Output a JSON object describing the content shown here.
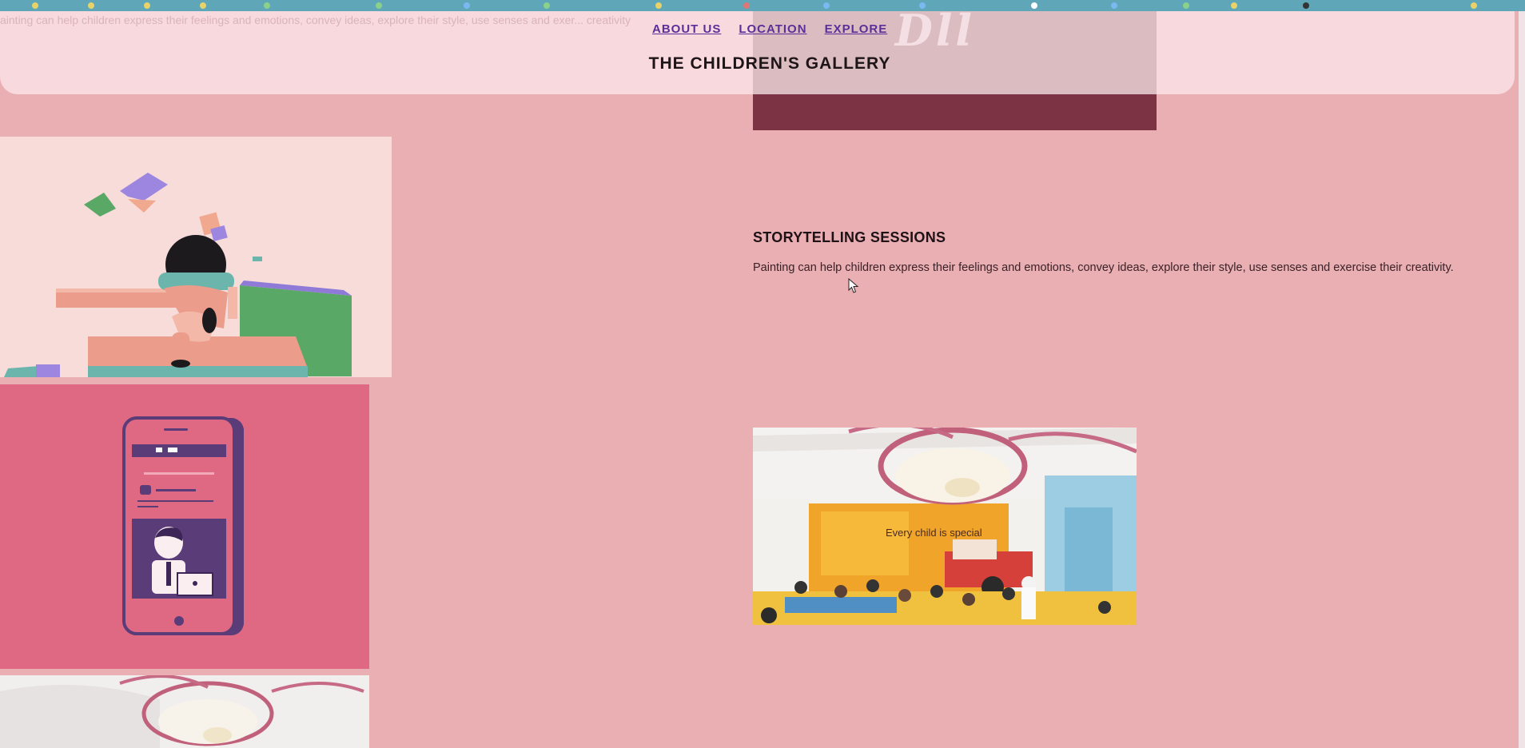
{
  "ghost_text": "ainting can help children express their feelings and emotions, convey ideas, explore their style, use senses and exer... creativity",
  "nav": {
    "about": "ABOUT US",
    "location": "LOCATION",
    "explore": "EXPLORE"
  },
  "site_title": "THE CHILDREN'S GALLERY",
  "section": {
    "heading": "STORYTELLING SESSIONS",
    "body": "Painting can help children express their feelings and emotions, convey ideas, explore their style, use senses and exercise their creativity."
  },
  "photo_caption": "Every child is special",
  "colors": {
    "page_bg": "#e9afb3",
    "header_band": "#fae1e4",
    "nav_link": "#5b2f9a",
    "dark_block": "#7c3444",
    "phone_panel": "#df6883",
    "bookmark_bar": "#5ea6b8"
  },
  "icons": [
    "cursor-icon",
    "phone-illustration",
    "girl-illustration"
  ]
}
